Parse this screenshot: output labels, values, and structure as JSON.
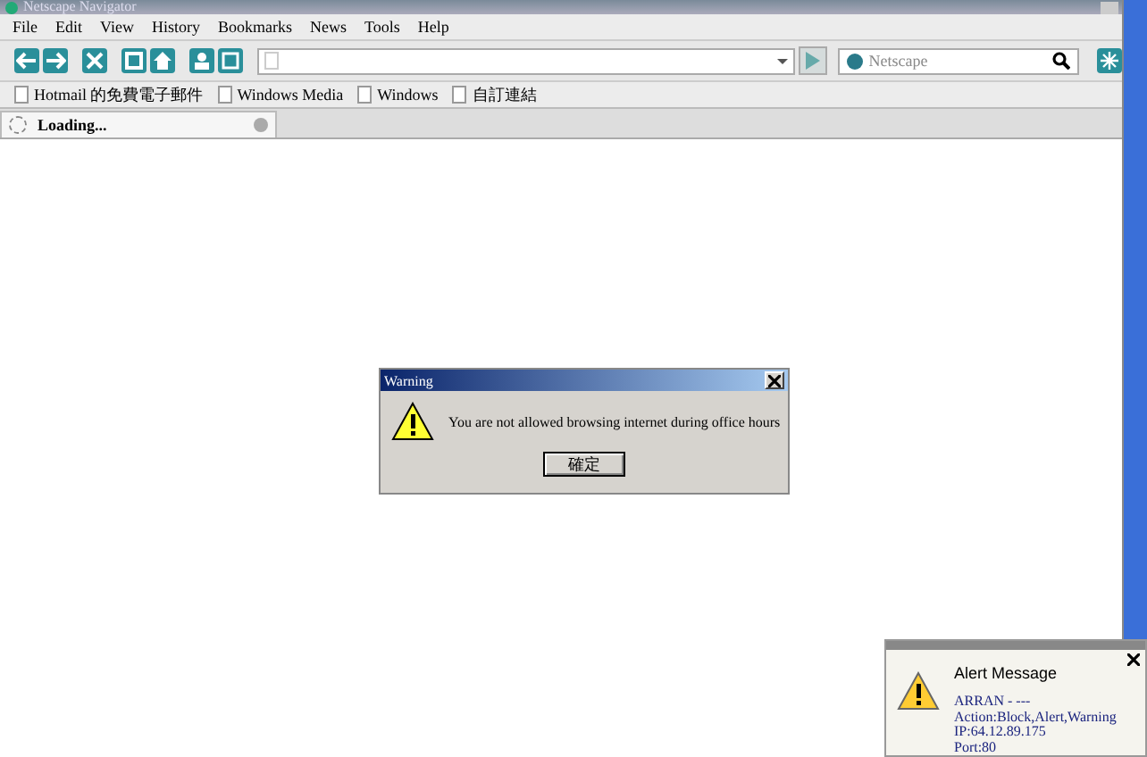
{
  "window": {
    "title": "Netscape Navigator"
  },
  "menu": [
    "File",
    "Edit",
    "View",
    "History",
    "Bookmarks",
    "News",
    "Tools",
    "Help"
  ],
  "search": {
    "placeholder": "Netscape"
  },
  "bookmarks": [
    "Hotmail 的免費電子郵件",
    "Windows Media",
    "Windows",
    "自訂連結"
  ],
  "tabs": [
    {
      "label": "Loading...",
      "selected": true
    }
  ],
  "dialog": {
    "title": "Warning",
    "message": "You are not allowed browsing internet during office hours",
    "button": "確定"
  },
  "alert": {
    "title": "Alert Message",
    "lines": [
      "ARRAN - ---",
      "Action:Block,Alert,Warning",
      "IP:64.12.89.175",
      "Port:80"
    ]
  }
}
